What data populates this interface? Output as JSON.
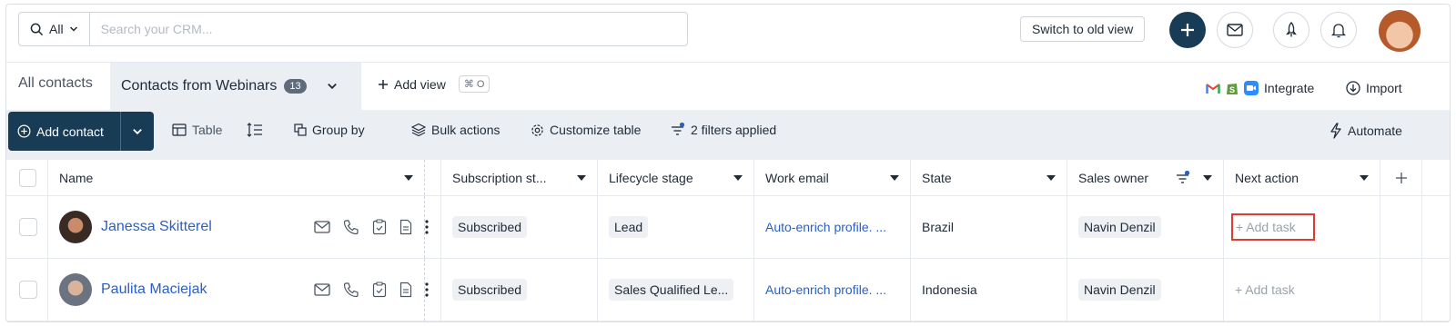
{
  "search": {
    "scope": "All",
    "placeholder": "Search your CRM..."
  },
  "topbar": {
    "switch_label": "Switch to old view"
  },
  "tabs": {
    "all_label": "All contacts",
    "active_label": "Contacts from Webinars",
    "active_count": "13",
    "add_view_label": "Add view",
    "shortcut": "⌘ O"
  },
  "integrations": {
    "integrate_label": "Integrate",
    "import_label": "Import"
  },
  "toolbar": {
    "add_contact_label": "Add contact",
    "table_label": "Table",
    "group_by_label": "Group by",
    "bulk_actions_label": "Bulk actions",
    "customize_label": "Customize table",
    "filters_label": "2 filters applied",
    "automate_label": "Automate"
  },
  "columns": {
    "name": "Name",
    "subscription": "Subscription st...",
    "lifecycle": "Lifecycle stage",
    "email": "Work email",
    "state": "State",
    "owner": "Sales owner",
    "next_action": "Next action"
  },
  "rows": [
    {
      "name": "Janessa Skitterel",
      "subscription": "Subscribed",
      "lifecycle": "Lead",
      "email": "Auto-enrich profile. ...",
      "state": "Brazil",
      "owner": "Navin Denzil",
      "next_action": "+ Add task"
    },
    {
      "name": "Paulita Maciejak",
      "subscription": "Subscribed",
      "lifecycle": "Sales Qualified Le...",
      "email": "Auto-enrich profile. ...",
      "state": "Indonesia",
      "owner": "Navin Denzil",
      "next_action": "+ Add task"
    }
  ],
  "colors": {
    "primary": "#183b56",
    "link": "#2b5fc6",
    "highlight": "#e23a2e",
    "toolbar_bg": "#ebeff3",
    "filter_dot": "#2b5fc6"
  },
  "icons": [
    "search-icon",
    "chevron-down-icon",
    "plus-icon",
    "mail-icon",
    "rocket-icon",
    "bell-icon",
    "gmail-icon",
    "shopify-icon",
    "zoom-icon",
    "import-icon",
    "table-icon",
    "row-height-icon",
    "group-icon",
    "layers-icon",
    "gear-icon",
    "filter-icon",
    "bolt-icon",
    "phone-icon",
    "task-icon",
    "note-icon",
    "more-icon"
  ]
}
